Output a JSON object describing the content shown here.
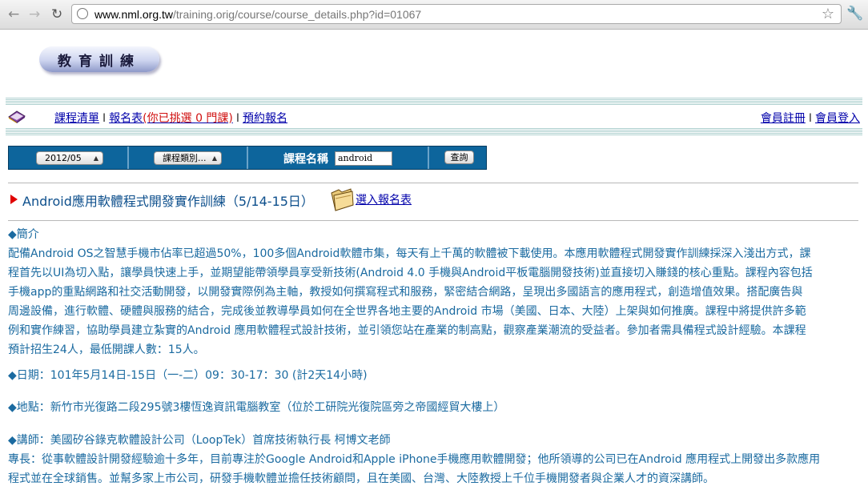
{
  "browser": {
    "url_host": "www.nml.org.tw",
    "url_path": "/training.orig/course/course_details.php?id=01067"
  },
  "logo": {
    "text": "教育訓練"
  },
  "nav": {
    "course_list": "課程清單",
    "signup_form": "報名表",
    "selected_prefix": "(你已挑選 ",
    "selected_count": "0",
    "selected_suffix": " 門課)",
    "reserve": "預約報名",
    "separator": "I",
    "member_register": "會員註冊",
    "member_login": "會員登入"
  },
  "search": {
    "month": "2012/05",
    "category": "課程類別...",
    "name_label": "課程名稱",
    "keyword": "android",
    "submit": "查詢"
  },
  "course": {
    "title": "Android應用軟體程式開發實作訓練（5/14-15日）",
    "select_link": "選入報名表"
  },
  "details": {
    "intro_heading": "◆簡介",
    "intro_lines": [
      "配備Android OS之智慧手機市佔率已超過50%，100多個Android軟體市集，每天有上千萬的軟體被下載使用。本應用軟體程式開發實作訓練採深入淺出方式，課",
      "程首先以UI為切入點，讓學員快速上手，並期望能帶領學員享受新技術(Android 4.0 手機與Android平板電腦開發技術)並直接切入賺錢的核心重點。課程內容包括",
      "手機app的重點網路和社交活動開發，以開發實際例為主軸，教授如何撰寫程式和服務，緊密結合網路，呈現出多國語言的應用程式，創造增值效果。搭配廣告與",
      "周邊設備，進行軟體、硬體與服務的結合，完成後並教導學員如何在全世界各地主要的Android 市場（美國、日本、大陸）上架與如何推廣。課程中將提供許多範",
      "例和實作練習，協助學員建立紮實的Android 應用軟體程式設計技術，並引領您站在產業的制高點，觀察產業潮流的受益者。參加者需具備程式設計經驗。本課程",
      "預計招生24人，最低開課人數：15人。"
    ],
    "date_line": "◆日期：101年5月14日-15日（一-二）09：30-17：30 (計2天14小時)",
    "place_line": "◆地點：新竹市光復路二段295號3樓恆逸資訊電腦教室（位於工研院光復院區旁之帝國經貿大樓上）",
    "teacher_line": "◆講師：美國矽谷錄克軟體設計公司（LoopTek）首席技術執行長 柯博文老師",
    "expertise_lines": [
      "專長：從事軟體設計開發經驗逾十多年，目前專注於Google Android和Apple iPhone手機應用軟體開發；他所領導的公司已在Android 應用程式上開發出多款應用",
      "程式並在全球銷售。並幫多家上市公司，研發手機軟體並擔任技術顧問，且在美國、台灣、大陸教授上千位手機開發者與企業人才的資深講師。"
    ]
  }
}
